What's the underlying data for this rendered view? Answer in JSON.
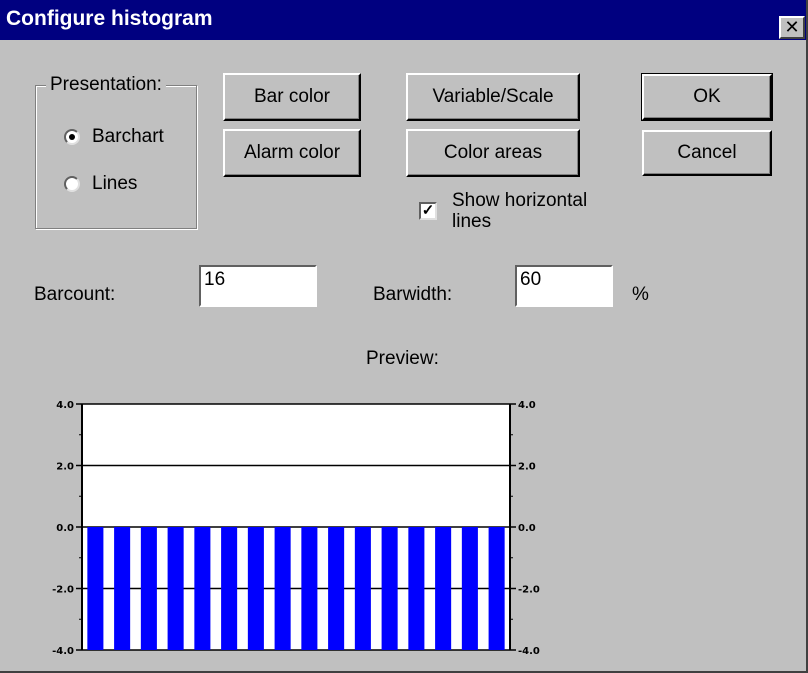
{
  "dialog": {
    "title": "Configure histogram",
    "close_label": "✕"
  },
  "presentation": {
    "label": "Presentation:",
    "options": [
      {
        "label": "Barchart",
        "selected": true
      },
      {
        "label": "Lines",
        "selected": false
      }
    ]
  },
  "buttons": {
    "bar_color": "Bar color",
    "alarm_color": "Alarm color",
    "variable_scale": "Variable/Scale",
    "color_areas": "Color areas",
    "ok": "OK",
    "cancel": "Cancel"
  },
  "show_horizontal_lines": {
    "label_line1": "Show horizontal",
    "label_line2": "lines",
    "checked": true
  },
  "barcount": {
    "label": "Barcount:",
    "value": "16"
  },
  "barwidth": {
    "label": "Barwidth:",
    "value": "60",
    "unit": "%"
  },
  "preview": {
    "label": "Preview:"
  },
  "chart_data": {
    "type": "bar",
    "bar_count": 16,
    "values": [
      -4.0,
      -4.0,
      -4.0,
      -4.0,
      -4.0,
      -4.0,
      -4.0,
      -4.0,
      -4.0,
      -4.0,
      -4.0,
      -4.0,
      -4.0,
      -4.0,
      -4.0,
      -4.0
    ],
    "baseline": 0.0,
    "ylim": [
      -4.0,
      4.0
    ],
    "y_ticks": [
      "4.0",
      "2.0",
      "0.0",
      "-2.0",
      "-4.0"
    ],
    "grid": true,
    "bar_color": "#0000ff",
    "grid_color": "#000000"
  }
}
